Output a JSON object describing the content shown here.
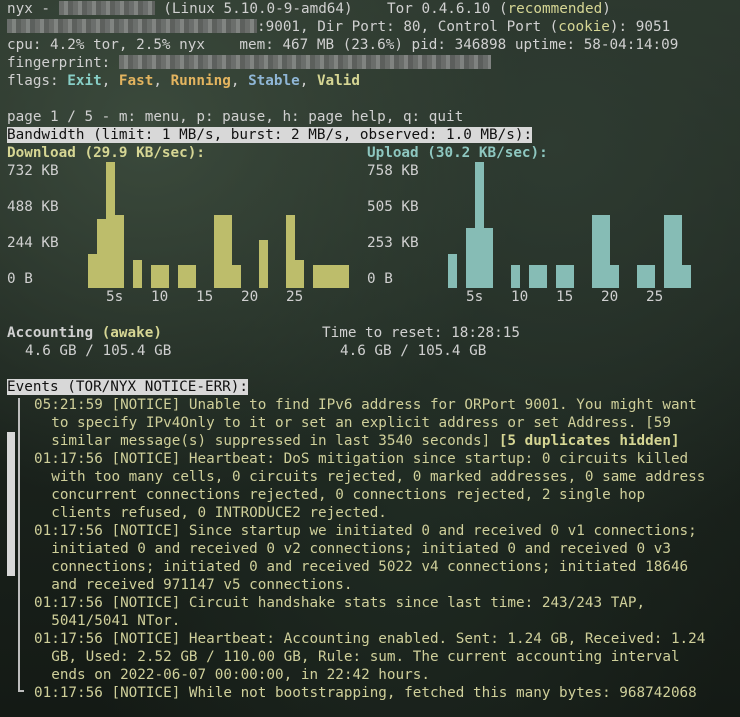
{
  "header": {
    "line1_prefix": "nyx - ",
    "line1_mid": " (Linux 5.10.0-9-amd64)    Tor 0.4.6.10 (",
    "line1_rec": "recommended",
    "line1_end": ")",
    "line2_ports": ":9001, Dir Port: 80, Control Port (",
    "line2_cookie": "cookie",
    "line2_end": "): 9051",
    "line3": "cpu: 4.2% tor, 2.5% nyx    mem: 467 MB (23.6%) pid: 346898 uptime: 58-04:14:09",
    "fingerprint_label": "fingerprint: ",
    "flags_label": "flags: ",
    "flags": [
      "Exit",
      "Fast",
      "Running",
      "Stable",
      "Valid"
    ],
    "flag_colors": [
      "#88cfc7",
      "#e3b45f",
      "#e3b45f",
      "#8fb6d6",
      "#d6d694"
    ]
  },
  "page_line": "page 1 / 5 - m: menu, p: pause, h: page help, q: quit",
  "bandwidth_title": "Bandwidth (limit: 1 MB/s, burst: 2 MB/s, observed: 1.0 MB/s):",
  "download": {
    "title": "Download (29.9 KB/sec):",
    "yticks": [
      "732 KB",
      "488 KB",
      "244 KB",
      "0 B"
    ],
    "xticks": [
      "5s",
      "10",
      "15",
      "20",
      "25"
    ],
    "values": [
      0.27,
      0.55,
      1.0,
      0.58,
      0.0,
      0.22,
      0.0,
      0.18,
      0.18,
      0.0,
      0.18,
      0.18,
      0.0,
      0.0,
      0.58,
      0.58,
      0.18,
      0.0,
      0.0,
      0.38,
      0.0,
      0.0,
      0.58,
      0.22,
      0.0,
      0.18,
      0.18,
      0.18,
      0.18
    ],
    "color": "#bdbd6b"
  },
  "upload": {
    "title": "Upload (30.2 KB/sec):",
    "yticks": [
      "758 KB",
      "505 KB",
      "253 KB",
      "0 B"
    ],
    "xticks": [
      "5s",
      "10",
      "15",
      "20",
      "25"
    ],
    "values": [
      0.27,
      0.0,
      0.48,
      1.0,
      0.48,
      0.0,
      0.0,
      0.18,
      0.0,
      0.18,
      0.18,
      0.0,
      0.18,
      0.18,
      0.0,
      0.0,
      0.58,
      0.58,
      0.18,
      0.0,
      0.0,
      0.18,
      0.18,
      0.0,
      0.58,
      0.58,
      0.18,
      0.0,
      0.0
    ],
    "color": "#86bcb5"
  },
  "accounting": {
    "label": "Accounting",
    "state": "(awake)",
    "reset": "Time to reset: 18:28:15",
    "left_usage": "4.6 GB / 105.4 GB",
    "right_usage": "4.6 GB / 105.4 GB"
  },
  "events_title": "Events (TOR/NYX NOTICE-ERR):",
  "events": [
    "05:21:59 [NOTICE] Unable to find IPv6 address for ORPort 9001. You might want",
    "  to specify IPv4Only to it or set an explicit address or set Address. [59",
    "  similar message(s) suppressed in last 3540 seconds] ",
    "01:17:56 [NOTICE] Heartbeat: DoS mitigation since startup: 0 circuits killed",
    "  with too many cells, 0 circuits rejected, 0 marked addresses, 0 same address",
    "  concurrent connections rejected, 0 connections rejected, 2 single hop",
    "  clients refused, 0 INTRODUCE2 rejected.",
    "01:17:56 [NOTICE] Since startup we initiated 0 and received 0 v1 connections;",
    "  initiated 0 and received 0 v2 connections; initiated 0 and received 0 v3",
    "  connections; initiated 0 and received 5022 v4 connections; initiated 18646",
    "  and received 971147 v5 connections.",
    "01:17:56 [NOTICE] Circuit handshake stats since last time: 243/243 TAP,",
    "  5041/5041 NTor.",
    "01:17:56 [NOTICE] Heartbeat: Accounting enabled. Sent: 1.24 GB, Received: 1.24",
    "  GB, Used: 2.52 GB / 110.00 GB, Rule: sum. The current accounting interval",
    "  ends on 2022-06-07 00:00:00, in 22:42 hours.",
    "01:17:56 [NOTICE] While not bootstrapping, fetched this many bytes: 968742068"
  ],
  "duplicates_hidden": "[5 duplicates hidden]"
}
